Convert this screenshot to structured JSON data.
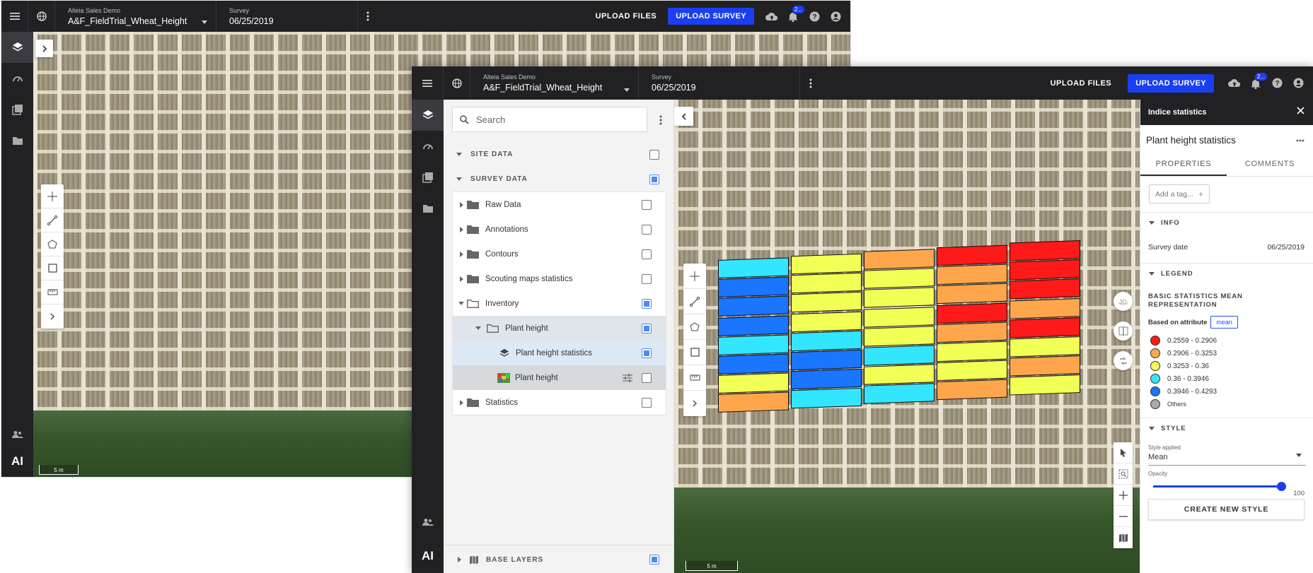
{
  "background_window": {
    "org": "Alteia Sales Demo",
    "project": "A&F_FieldTrial_Wheat_Height",
    "survey_label": "Survey",
    "survey_date": "06/25/2019",
    "upload_files": "UPLOAD FILES",
    "upload_survey": "UPLOAD SURVEY",
    "badge": "2...",
    "scale": "5 m",
    "logo": "AI"
  },
  "main_window": {
    "org": "Alteia Sales Demo",
    "project": "A&F_FieldTrial_Wheat_Height",
    "survey_label": "Survey",
    "survey_date": "06/25/2019",
    "upload_files": "UPLOAD FILES",
    "upload_survey": "UPLOAD SURVEY",
    "badge": "2...",
    "scale": "5 m",
    "logo": "AI",
    "accent": "#1a3ff0"
  },
  "layers": {
    "search_placeholder": "Search",
    "site_data": "SITE DATA",
    "survey_data": "SURVEY DATA",
    "raw_data": "Raw Data",
    "annotations": "Annotations",
    "contours": "Contours",
    "scouting": "Scouting maps statistics",
    "inventory": "Inventory",
    "plant_height_group": "Plant height",
    "plant_height_stats": "Plant height statistics",
    "plant_height_raster": "Plant height",
    "statistics": "Statistics",
    "base_layers": "BASE LAYERS"
  },
  "stats_panel": {
    "header": "Indice statistics",
    "title": "Plant height statistics",
    "tab_properties": "PROPERTIES",
    "tab_comments": "COMMENTS",
    "tag_placeholder": "Add a tag...",
    "info": "INFO",
    "survey_date_label": "Survey date",
    "survey_date_value": "06/25/2019",
    "legend": "LEGEND",
    "legend_title": "BASIC STATISTICS MEAN REPRESENTATION",
    "based_on": "Based on attribute",
    "attribute": "mean",
    "legend_items": [
      {
        "label": "0.2559 - 0.2906",
        "color": "#ff1a1a"
      },
      {
        "label": "0.2906 - 0.3253",
        "color": "#ffa64d"
      },
      {
        "label": "0.3253 - 0.36",
        "color": "#f2ff55"
      },
      {
        "label": "0.36 - 0.3946",
        "color": "#33e6ff"
      },
      {
        "label": "0.3946 - 0.4293",
        "color": "#1a75ff"
      },
      {
        "label": "Others",
        "color": "#aaaaaa"
      }
    ],
    "style": "STYLE",
    "style_applied_label": "Style applied",
    "style_applied_value": "Mean",
    "opacity_label": "Opacity",
    "opacity_value": "100",
    "create_style": "CREATE NEW STYLE"
  },
  "plot_grid": {
    "columns": [
      [
        "cyan",
        "blue",
        "blue",
        "blue",
        "cyan",
        "blue",
        "yellow",
        "orange"
      ],
      [
        "yellow",
        "yellow",
        "yellow",
        "yellow",
        "cyan",
        "blue",
        "blue",
        "cyan"
      ],
      [
        "orange",
        "yellow",
        "yellow",
        "yellow",
        "yellow",
        "cyan",
        "yellow",
        "cyan"
      ],
      [
        "red",
        "orange",
        "orange",
        "red",
        "orange",
        "yellow",
        "yellow",
        "orange"
      ],
      [
        "red",
        "red",
        "red",
        "orange",
        "red",
        "yellow",
        "orange",
        "yellow"
      ]
    ]
  }
}
